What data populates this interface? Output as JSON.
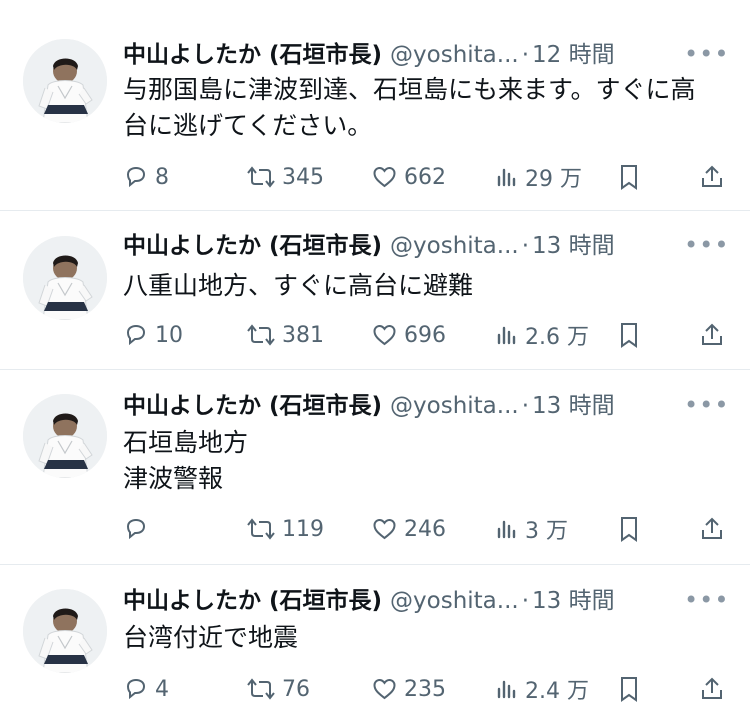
{
  "accent": "#0f1419",
  "secondary_text_color": "#536471",
  "tweets": [
    {
      "name": "中山よしたか (石垣市長)",
      "handle": "@yoshita...",
      "dot": "·",
      "time": "12 時間",
      "more": "•••",
      "text": "与那国島に津波到達、石垣島にも来ます。すぐに高\n台に逃げてください。",
      "replies": "8",
      "retweets": "345",
      "likes": "662",
      "views": "29 万"
    },
    {
      "name": "中山よしたか (石垣市長)",
      "handle": "@yoshita...",
      "dot": "·",
      "time": "13 時間",
      "more": "•••",
      "text": "八重山地方、すぐに高台に避難",
      "replies": "10",
      "retweets": "381",
      "likes": "696",
      "views": "2.6 万"
    },
    {
      "name": "中山よしたか (石垣市長)",
      "handle": "@yoshita...",
      "dot": "·",
      "time": "13 時間",
      "more": "•••",
      "text": "石垣島地方\n津波警報",
      "replies": "",
      "retweets": "119",
      "likes": "246",
      "views": "3 万"
    },
    {
      "name": "中山よしたか (石垣市長)",
      "handle": "@yoshita...",
      "dot": "·",
      "time": "13 時間",
      "more": "•••",
      "text": "台湾付近で地震",
      "replies": "4",
      "retweets": "76",
      "likes": "235",
      "views": "2.4 万"
    }
  ],
  "icons": {
    "reply": "reply-icon",
    "retweet": "retweet-icon",
    "like": "heart-icon",
    "views": "views-bar-chart-icon",
    "bookmark": "bookmark-icon",
    "share": "share-upload-icon",
    "more": "more-dots-icon"
  }
}
